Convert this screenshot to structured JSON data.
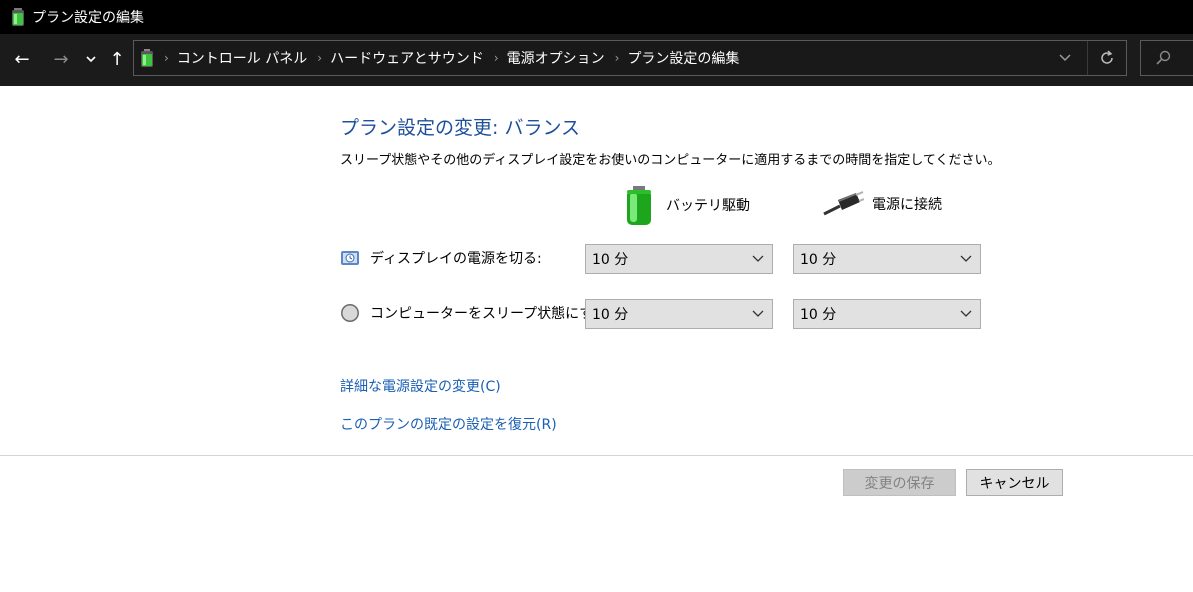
{
  "window": {
    "title": "プラン設定の編集"
  },
  "nav": {
    "back_glyph": "←",
    "forward_glyph": "→",
    "recent_glyph": "⌄",
    "up_glyph": "↑"
  },
  "breadcrumb": [
    "コントロール パネル",
    "ハードウェアとサウンド",
    "電源オプション",
    "プラン設定の編集"
  ],
  "main": {
    "heading": "プラン設定の変更: バランス",
    "description": "スリープ状態やその他のディスプレイ設定をお使いのコンピューターに適用するまでの時間を指定してください。",
    "columns": {
      "battery": "バッテリ駆動",
      "plugged": "電源に接続"
    },
    "rows": [
      {
        "label": "ディスプレイの電源を切る:",
        "battery_value": "10 分",
        "plugged_value": "10 分",
        "icon": "display-timer-icon"
      },
      {
        "label": "コンピューターをスリープ状態にする:",
        "battery_value": "10 分",
        "plugged_value": "10 分",
        "icon": "sleep-moon-icon"
      }
    ],
    "links": {
      "advanced": "詳細な電源設定の変更(C)",
      "restore": "このプランの既定の設定を復元(R)"
    }
  },
  "buttons": {
    "save": "変更の保存",
    "cancel": "キャンセル"
  },
  "colors": {
    "heading": "#1e4f9a",
    "link": "#1a5fb4",
    "titlebar": "#000000",
    "navbar": "#1b1b1b"
  }
}
